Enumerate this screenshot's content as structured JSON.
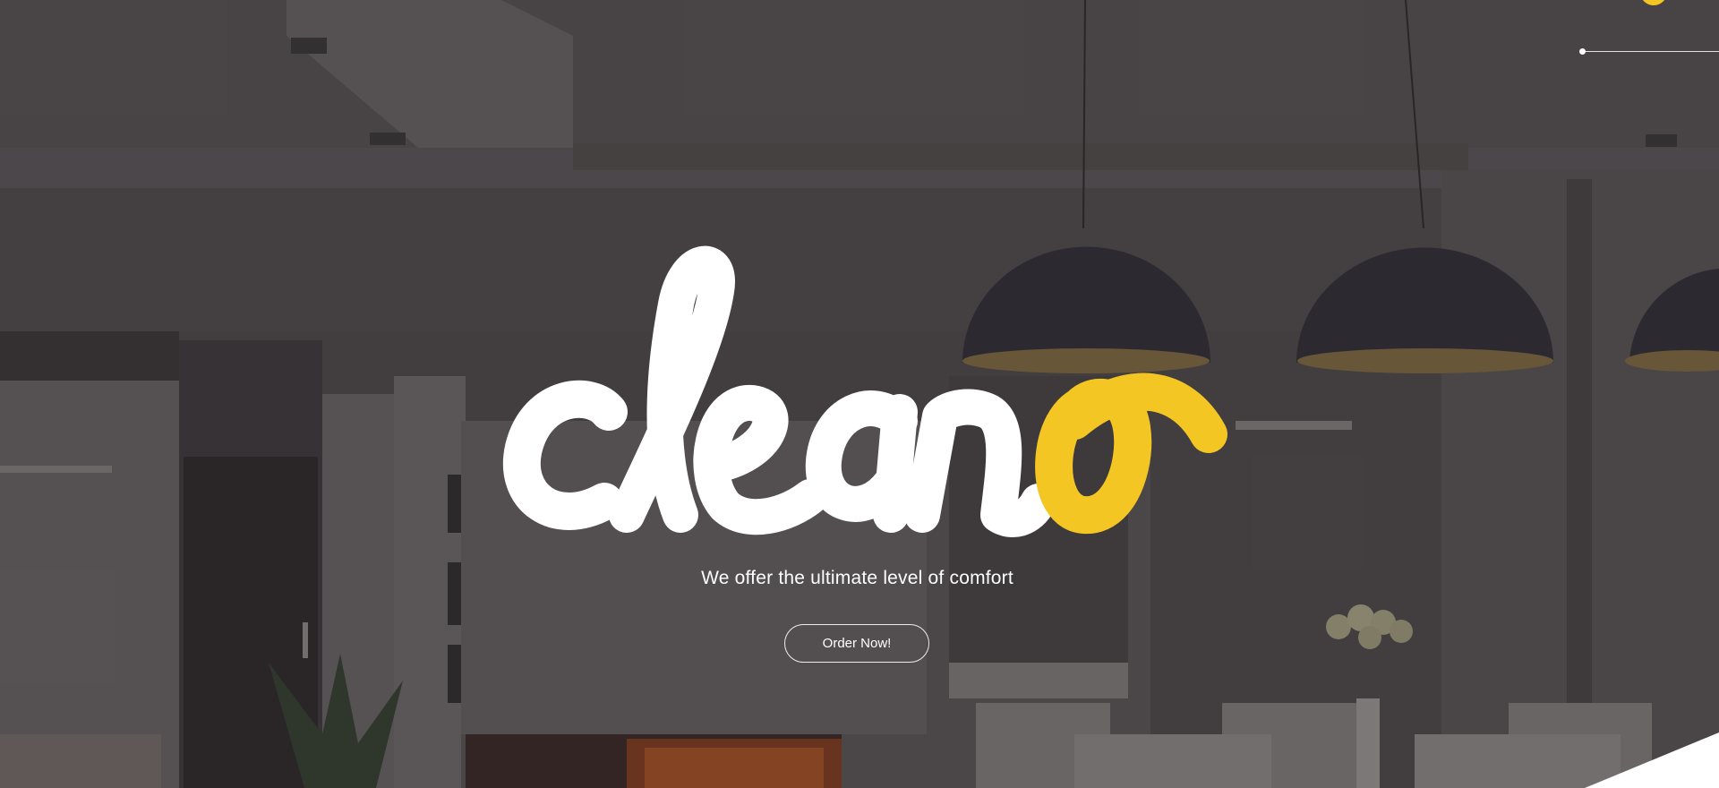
{
  "hero": {
    "logo_text_main": "clean",
    "logo_text_accent": "o",
    "tagline": "We offer the ultimate level of comfort",
    "cta_label": "Order Now!"
  },
  "colors": {
    "accent": "#f3c623",
    "text": "#ffffff",
    "overlay": "#4a4648"
  },
  "icons": {
    "slider_indicator": "slider-line-icon",
    "corner_badge": "circle-badge-icon"
  }
}
